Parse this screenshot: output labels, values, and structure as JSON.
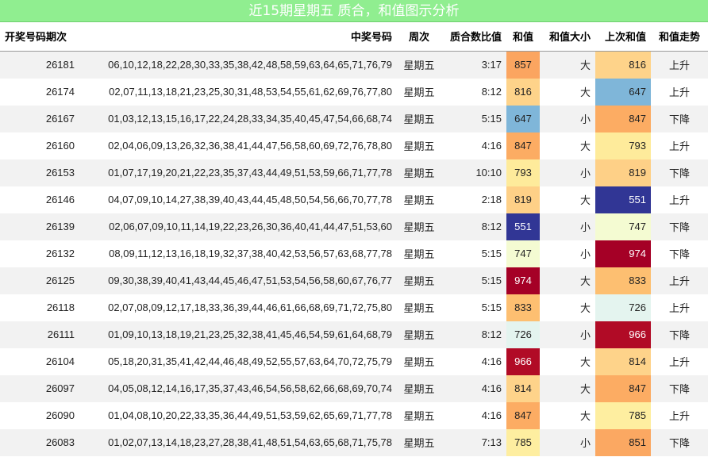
{
  "title": "近15期星期五 质合，和值图示分析",
  "headers": [
    "开奖号码期次",
    "中奖号码",
    "周次",
    "质合数比值",
    "和值",
    "和值大小",
    "上次和值",
    "和值走势"
  ],
  "rows": [
    {
      "id": "26181",
      "nums": "06,10,12,18,22,28,30,33,35,38,42,48,58,59,63,64,65,71,76,79",
      "week": "星期五",
      "ratio": "3:17",
      "sum": "857",
      "sum_color": "#fba560",
      "size": "大",
      "prev": "816",
      "prev_color": "#fed38a",
      "trend": "上升"
    },
    {
      "id": "26174",
      "nums": "02,07,11,13,18,21,23,25,30,31,48,53,54,55,61,62,69,76,77,80",
      "week": "星期五",
      "ratio": "8:12",
      "sum": "816",
      "sum_color": "#fed38a",
      "size": "大",
      "prev": "647",
      "prev_color": "#7fb6d9",
      "trend": "上升"
    },
    {
      "id": "26167",
      "nums": "01,03,12,13,15,16,17,22,24,28,33,34,35,40,45,47,54,66,68,74",
      "week": "星期五",
      "ratio": "5:15",
      "sum": "647",
      "sum_color": "#7fb6d9",
      "size": "小",
      "prev": "847",
      "prev_color": "#fcac63",
      "trend": "下降"
    },
    {
      "id": "26160",
      "nums": "02,04,06,09,13,26,32,36,38,41,44,47,56,58,60,69,72,76,78,80",
      "week": "星期五",
      "ratio": "4:16",
      "sum": "847",
      "sum_color": "#fcac63",
      "size": "大",
      "prev": "793",
      "prev_color": "#feeb9b",
      "trend": "上升"
    },
    {
      "id": "26153",
      "nums": "01,07,17,19,20,21,22,23,35,37,43,44,49,51,53,59,66,71,77,78",
      "week": "星期五",
      "ratio": "10:10",
      "sum": "793",
      "sum_color": "#feeb9b",
      "size": "小",
      "prev": "819",
      "prev_color": "#fed087",
      "trend": "下降"
    },
    {
      "id": "26146",
      "nums": "04,07,09,10,14,27,38,39,40,43,44,45,48,50,54,56,66,70,77,78",
      "week": "星期五",
      "ratio": "2:18",
      "sum": "819",
      "sum_color": "#fed087",
      "size": "大",
      "prev": "551",
      "prev_color": "#313695",
      "trend": "上升"
    },
    {
      "id": "26139",
      "nums": "02,06,07,09,10,11,14,19,22,23,26,30,36,40,41,44,47,51,53,60",
      "week": "星期五",
      "ratio": "8:12",
      "sum": "551",
      "sum_color": "#313695",
      "size": "小",
      "prev": "747",
      "prev_color": "#f4fbd2",
      "trend": "下降"
    },
    {
      "id": "26132",
      "nums": "08,09,11,12,13,16,18,19,32,37,38,40,42,53,56,57,63,68,77,78",
      "week": "星期五",
      "ratio": "5:15",
      "sum": "747",
      "sum_color": "#f4fbd2",
      "size": "小",
      "prev": "974",
      "prev_color": "#a50026",
      "trend": "下降"
    },
    {
      "id": "26125",
      "nums": "09,30,38,39,40,41,43,44,45,46,47,51,53,54,56,58,60,67,76,77",
      "week": "星期五",
      "ratio": "5:15",
      "sum": "974",
      "sum_color": "#a50026",
      "size": "大",
      "prev": "833",
      "prev_color": "#fdbf71",
      "trend": "上升"
    },
    {
      "id": "26118",
      "nums": "02,07,08,09,12,17,18,33,36,39,44,46,61,66,68,69,71,72,75,80",
      "week": "星期五",
      "ratio": "5:15",
      "sum": "833",
      "sum_color": "#fdbf71",
      "size": "大",
      "prev": "726",
      "prev_color": "#e4f4ef",
      "trend": "上升"
    },
    {
      "id": "26111",
      "nums": "01,09,10,13,18,19,21,23,25,32,38,41,45,46,54,59,61,64,68,79",
      "week": "星期五",
      "ratio": "8:12",
      "sum": "726",
      "sum_color": "#e4f4ef",
      "size": "小",
      "prev": "966",
      "prev_color": "#b10b26",
      "trend": "下降"
    },
    {
      "id": "26104",
      "nums": "05,18,20,31,35,41,42,44,46,48,49,52,55,57,63,64,70,72,75,79",
      "week": "星期五",
      "ratio": "4:16",
      "sum": "966",
      "sum_color": "#b10b26",
      "size": "大",
      "prev": "814",
      "prev_color": "#fed38a",
      "trend": "上升"
    },
    {
      "id": "26097",
      "nums": "04,05,08,12,14,16,17,35,37,43,46,54,56,58,62,66,68,69,70,74",
      "week": "星期五",
      "ratio": "4:16",
      "sum": "814",
      "sum_color": "#fed38a",
      "size": "大",
      "prev": "847",
      "prev_color": "#fcac63",
      "trend": "下降"
    },
    {
      "id": "26090",
      "nums": "01,04,08,10,20,22,33,35,36,44,49,51,53,59,62,65,69,71,77,78",
      "week": "星期五",
      "ratio": "4:16",
      "sum": "847",
      "sum_color": "#fcac63",
      "size": "大",
      "prev": "785",
      "prev_color": "#feeea0",
      "trend": "上升"
    },
    {
      "id": "26083",
      "nums": "01,02,07,13,14,18,23,27,28,38,41,48,51,54,63,65,68,71,75,78",
      "week": "星期五",
      "ratio": "7:13",
      "sum": "785",
      "sum_color": "#feeea0",
      "size": "小",
      "prev": "851",
      "prev_color": "#fba862",
      "trend": "下降"
    }
  ]
}
